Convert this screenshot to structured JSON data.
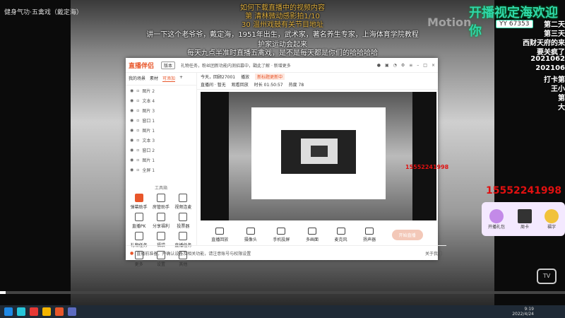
{
  "video": {
    "channel_title": "健身气功·五禽戏（戴定海）",
    "overlays": [
      "如何下载直播中的视频内容",
      "第 清林微动感影拍1/10",
      "30 温州戏鼓有关节目地址",
      "讲一下这个老爷爷，戴定海，1951年出生，武术家，著名养生专家，上海体育学院教程",
      "护家运动会起来",
      "每天九点半准时直播五禽戏，是不是每天都是你们的哈哈哈哈"
    ],
    "watermark": "Motion",
    "logo_text": "开播视定海欢迎你",
    "yy_id": "YY 67353",
    "side_messages": [
      "第二天",
      "第三天",
      "西财天府的来",
      "要关疯了",
      "2021062",
      "202106",
      "打卡第",
      "王小",
      "第",
      "大"
    ],
    "phone_big": "15552241998",
    "gift": {
      "items": [
        "开播礼包",
        "周卡",
        "福字"
      ]
    },
    "progress": 0.01,
    "bili_label": "TV"
  },
  "app": {
    "logo": "直播伴侣",
    "version_btn": "版本",
    "notice": "礼物任务，粉丝团新功能内测招募中，戳此了解 · 新增更多",
    "left_tabs": [
      "我的场景",
      "素材",
      "可添加",
      "+"
    ],
    "active_tab_index": 2,
    "scenes": [
      "图片 2",
      "文本 4",
      "图片 3",
      "窗口 1",
      "图片 1",
      "文本 3",
      "窗口 2",
      "图片 1",
      "全屏 1"
    ],
    "tools_title": "工具箱",
    "tools": [
      [
        "弹幕助手",
        "房管助手",
        "视频连麦"
      ],
      [
        "直播PK",
        "分享福利",
        "投票器"
      ],
      [
        "礼物任务",
        "福袋",
        "直播任务"
      ],
      [
        "更多",
        "设置",
        "其他"
      ]
    ],
    "room_line": "今天，回顾27001",
    "room_tags": [
      "播放",
      "新标题更新中"
    ],
    "stats_line": [
      "直播间 · 暂无",
      "观看回放",
      "时长 01:50:57",
      "热度 78"
    ],
    "inner_phone": "15552241998",
    "bottom_buttons": [
      "直播回放",
      "摄像头",
      "手机投屏",
      "多画面",
      "麦克风",
      "扬声器"
    ],
    "start_live": "开始直播",
    "status_text": "直播前准备，并确认设备及相关功能，请注意账号与权限设置",
    "status_right": "关于我们"
  },
  "taskbar": {
    "time": "9:19",
    "date": "2022/4/24"
  },
  "colors": {
    "accent": "#e8562a",
    "phone_red": "#e01010",
    "logo_green": "#2fd6a8"
  }
}
